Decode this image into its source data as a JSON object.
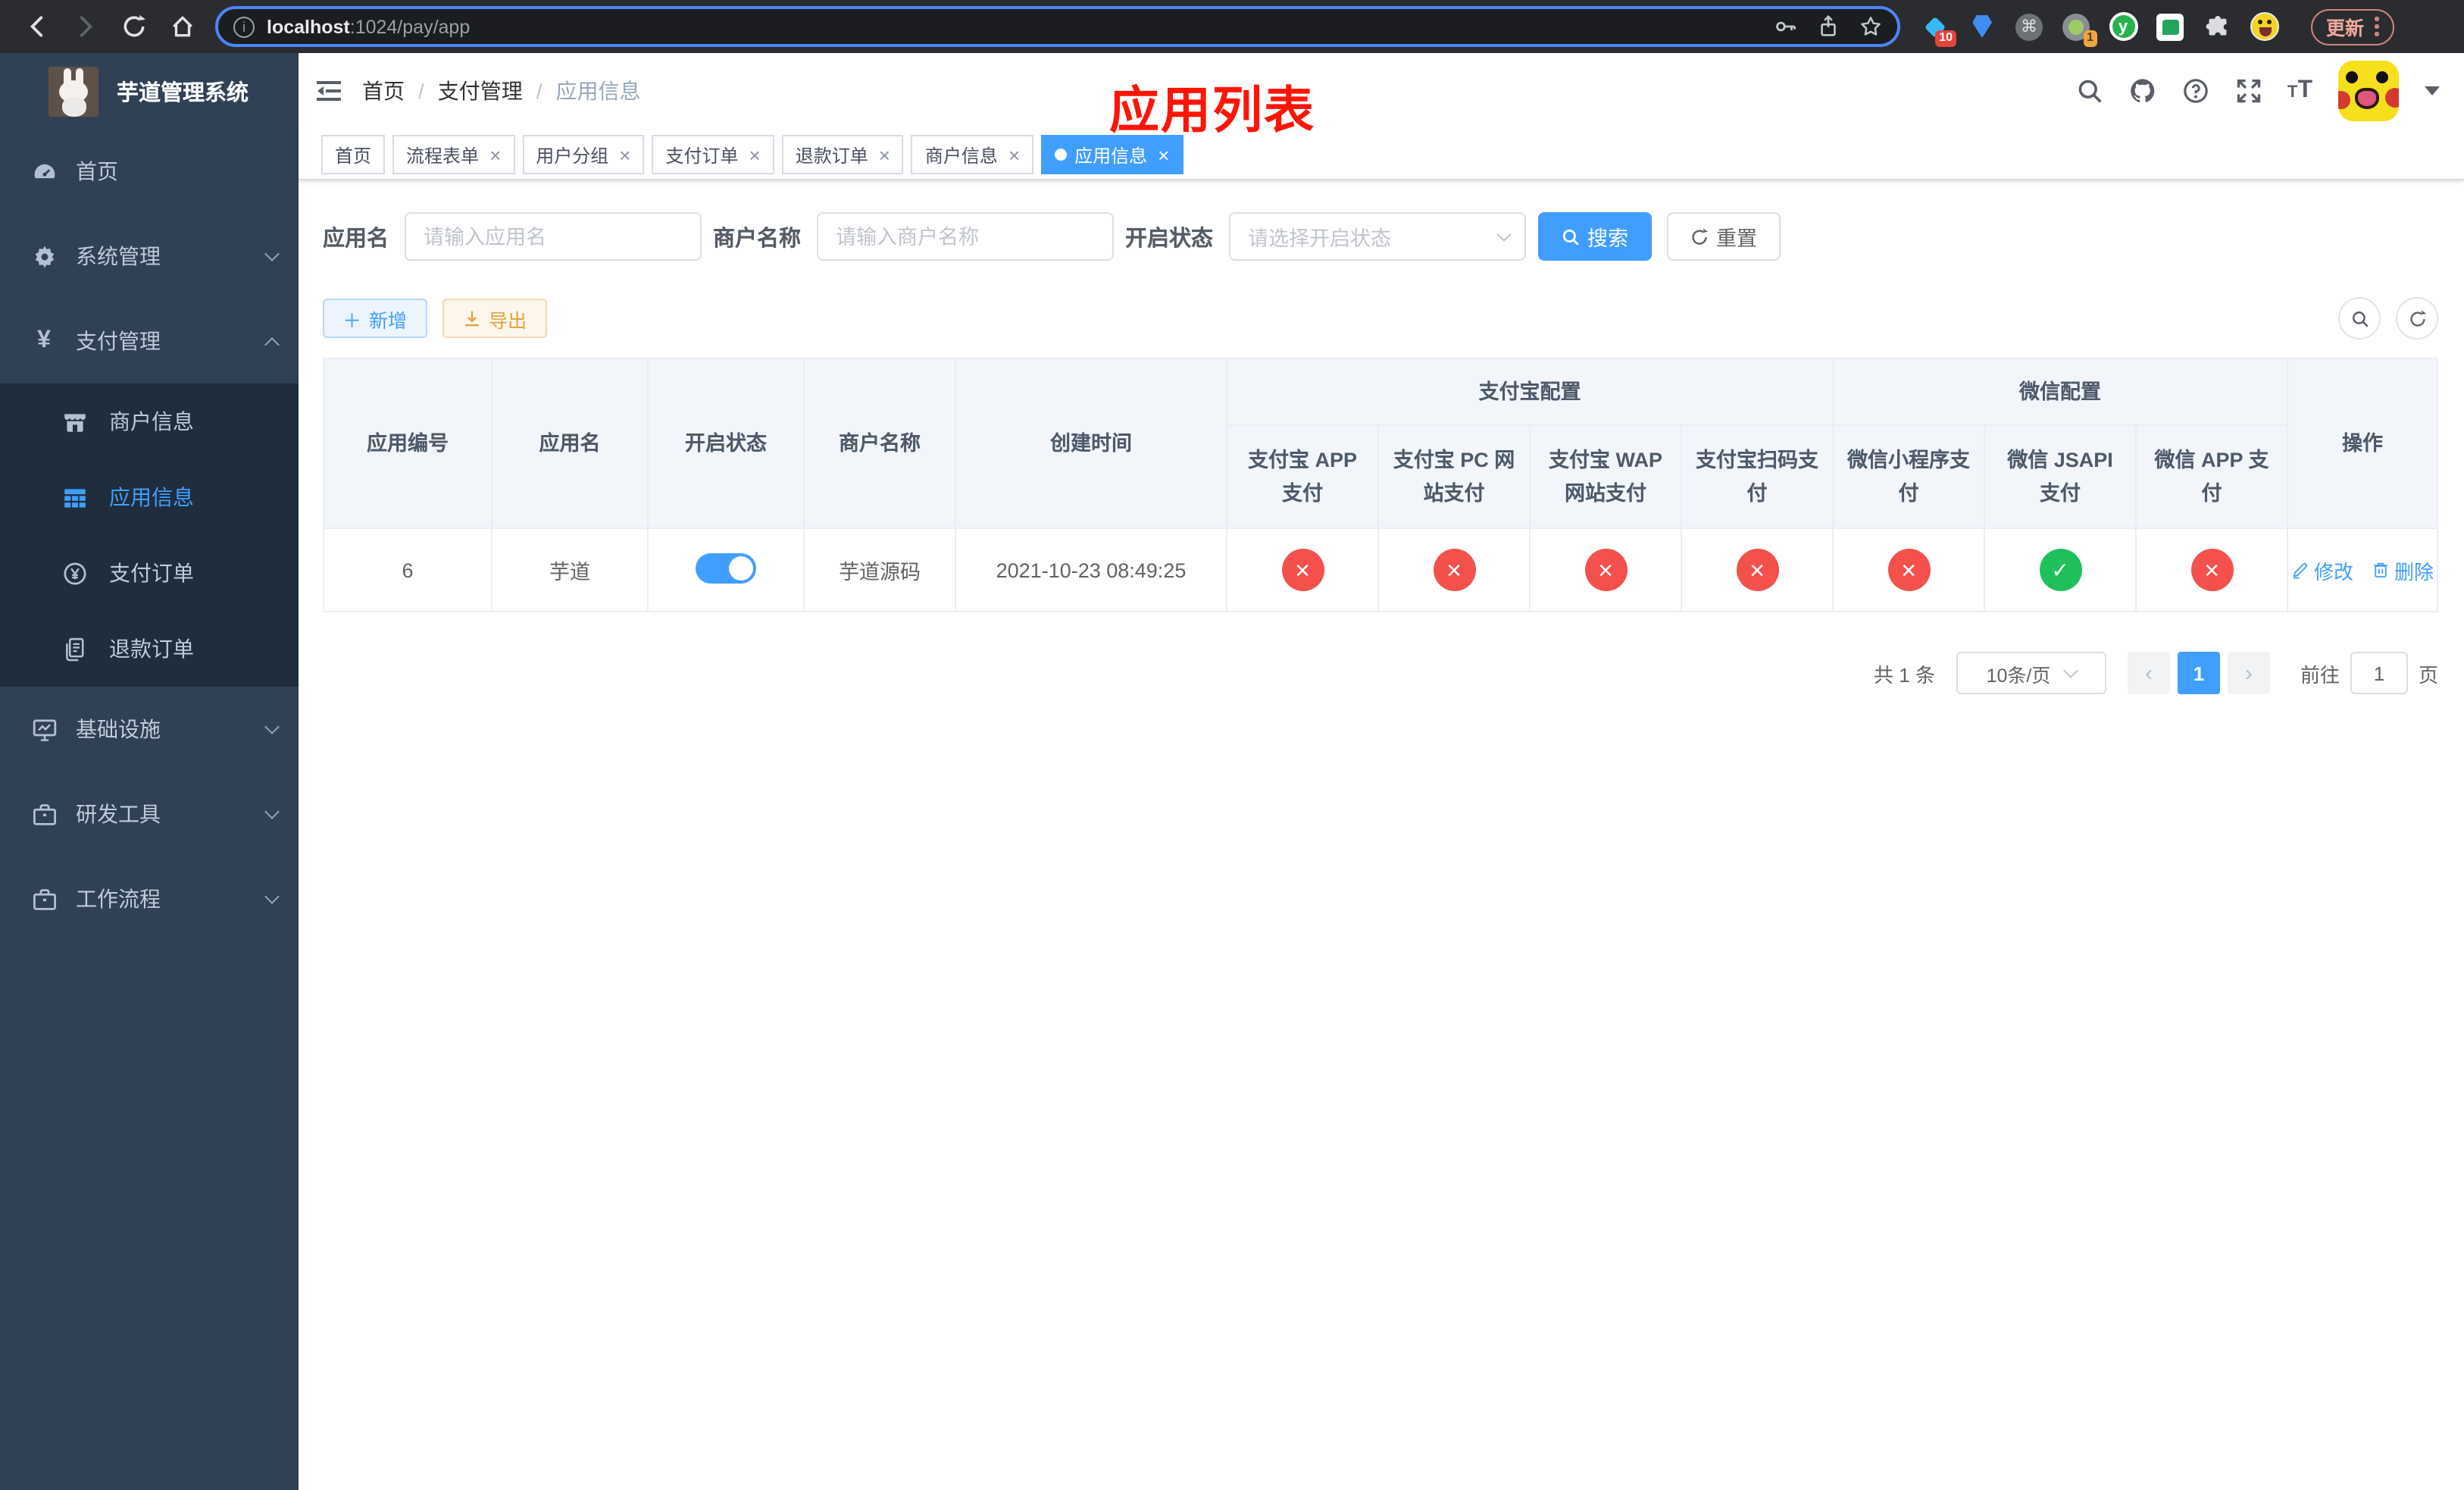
{
  "colors": {
    "accent": "#409eff",
    "success": "#1fc05c",
    "danger": "#f4514c",
    "warning": "#e6a23c",
    "sidebar_bg": "#304156",
    "submenu_bg": "#1f2d3d",
    "tab_active": "#409eff",
    "annotation_red": "#fe1507"
  },
  "browser": {
    "url_host": "localhost",
    "url_rest": ":1024/pay/app",
    "ext_badge_a": "10",
    "ext_badge_b": "1",
    "cmd_glyph": "⌘",
    "y_glyph": "y",
    "update_label": "更新"
  },
  "sidebar": {
    "title": "芋道管理系统",
    "items": [
      {
        "label": "首页"
      },
      {
        "label": "系统管理"
      },
      {
        "label": "支付管理"
      },
      {
        "label": "商户信息"
      },
      {
        "label": "应用信息"
      },
      {
        "label": "支付订单"
      },
      {
        "label": "退款订单"
      },
      {
        "label": "基础设施"
      },
      {
        "label": "研发工具"
      },
      {
        "label": "工作流程"
      }
    ],
    "yen_glyph": "¥"
  },
  "header": {
    "breadcrumb": [
      "首页",
      "支付管理",
      "应用信息"
    ],
    "separator": "/",
    "annotation": "应用列表"
  },
  "tabs": [
    {
      "label": "首页"
    },
    {
      "label": "流程表单"
    },
    {
      "label": "用户分组"
    },
    {
      "label": "支付订单"
    },
    {
      "label": "退款订单"
    },
    {
      "label": "商户信息"
    },
    {
      "label": "应用信息"
    }
  ],
  "filters": {
    "app_name_label": "应用名",
    "app_name_placeholder": "请输入应用名",
    "merchant_label": "商户名称",
    "merchant_placeholder": "请输入商户名称",
    "status_label": "开启状态",
    "status_placeholder": "请选择开启状态",
    "search_label": "搜索",
    "reset_label": "重置"
  },
  "toolbar": {
    "add_label": "新增",
    "add_glyph": "＋",
    "export_label": "导出"
  },
  "table": {
    "columns": [
      "应用编号",
      "应用名",
      "开启状态",
      "商户名称",
      "创建时间"
    ],
    "groups": [
      {
        "label": "支付宝配置",
        "children": [
          "支付宝 APP 支付",
          "支付宝 PC 网站支付",
          "支付宝 WAP 网站支付",
          "支付宝扫码支付"
        ]
      },
      {
        "label": "微信配置",
        "children": [
          "微信小程序支付",
          "微信 JSAPI 支付",
          "微信 APP 支付"
        ]
      }
    ],
    "action_column": "操作",
    "row": {
      "id": "6",
      "name": "芋道",
      "switch": "on",
      "merchant": "芋道源码",
      "created_at": "2021-10-23 08:49:25",
      "pay_statuses": [
        "fail",
        "fail",
        "fail",
        "fail",
        "fail",
        "ok",
        "fail"
      ],
      "edit_label": "修改",
      "delete_label": "删除"
    }
  },
  "pagination": {
    "total": "共 1 条",
    "page_size": "10条/页",
    "page": "1",
    "goto": "前往",
    "goto_value": "1",
    "unit": "页"
  }
}
